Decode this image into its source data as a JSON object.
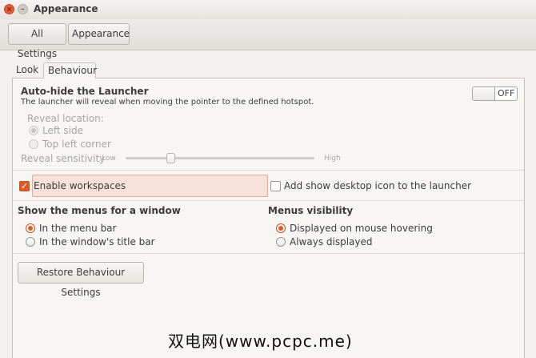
{
  "window": {
    "title": "Appearance",
    "close_glyph": "×",
    "minimize_glyph": "–"
  },
  "toolbar": {
    "all_settings_label": "All Settings",
    "appearance_label": "Appearance"
  },
  "tabs": {
    "look": "Look",
    "behaviour": "Behaviour"
  },
  "launcher": {
    "heading": "Auto-hide the Launcher",
    "description": "The launcher will reveal when moving the pointer to the defined hotspot.",
    "toggle_state": "OFF",
    "reveal_location_label": "Reveal location:",
    "left_side": "Left side",
    "top_left_corner": "Top left corner",
    "sensitivity_label": "Reveal sensitivity",
    "low": "Low",
    "high": "High",
    "sensitivity_value": 0.24
  },
  "workspaces": {
    "enable_label": "Enable workspaces",
    "enable_checked": true,
    "show_desktop_label": "Add show desktop icon to the launcher",
    "show_desktop_checked": false
  },
  "menus": {
    "heading": "Show the menus for a window",
    "menu_bar": "In the menu bar",
    "title_bar": "In the window's title bar",
    "selected": "menu_bar"
  },
  "visibility": {
    "heading": "Menus visibility",
    "mouse_hover": "Displayed on mouse hovering",
    "always": "Always displayed",
    "selected": "mouse_hover"
  },
  "restore_label": "Restore Behaviour Settings",
  "watermark": "双电网(www.pcpc.me)",
  "colors": {
    "accent": "#e05a28",
    "highlight_bg": "#f6e2da",
    "window_bg": "#f2f1f0"
  }
}
